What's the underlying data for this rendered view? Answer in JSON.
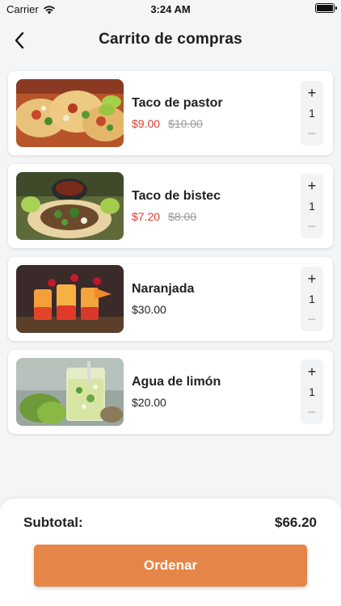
{
  "status_bar": {
    "carrier": "Carrier",
    "time": "3:24 AM"
  },
  "nav": {
    "title": "Carrito de compras",
    "back_icon": "chevron-left-icon"
  },
  "cart": {
    "items": [
      {
        "name": "Taco de pastor",
        "price": "$9.00",
        "old_price": "$10.00",
        "quantity": "1",
        "on_sale": true
      },
      {
        "name": "Taco de bistec",
        "price": "$7.20",
        "old_price": "$8.00",
        "quantity": "1",
        "on_sale": true
      },
      {
        "name": "Naranjada",
        "price": "$30.00",
        "old_price": "",
        "quantity": "1",
        "on_sale": false
      },
      {
        "name": "Agua de limón",
        "price": "$20.00",
        "old_price": "",
        "quantity": "1",
        "on_sale": false
      }
    ],
    "stepper": {
      "plus_label": "+",
      "minus_label": "−"
    }
  },
  "footer": {
    "subtotal_label": "Subtotal:",
    "subtotal_value": "$66.20",
    "order_label": "Ordenar"
  },
  "colors": {
    "accent": "#e58547",
    "sale_price": "#e0392b",
    "old_price": "#9a9a9a"
  }
}
